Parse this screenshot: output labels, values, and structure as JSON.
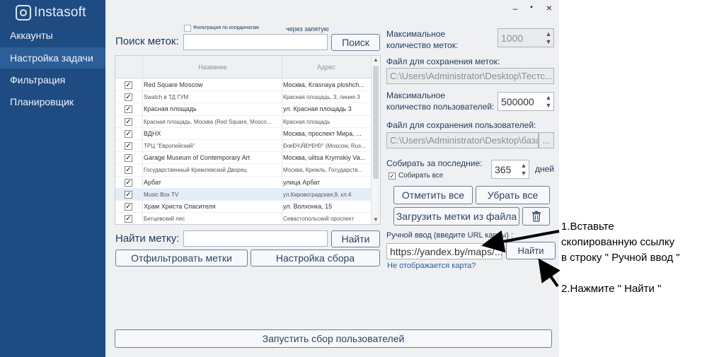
{
  "app": {
    "logo_text": "Instasoft"
  },
  "sidebar": {
    "items": [
      {
        "label": "Аккаунты"
      },
      {
        "label": "Настройка задачи"
      },
      {
        "label": "Фильтрация"
      },
      {
        "label": "Планировщик"
      }
    ],
    "active_index": 1
  },
  "window_controls": {
    "minimize": "–",
    "maximize": "▪",
    "close": "×"
  },
  "search": {
    "label": "Поиск меток:",
    "value": "",
    "button": "Поиск",
    "filter_coords_label": "Фильтрация по координатам",
    "comma_label": "через запятую"
  },
  "table": {
    "headers": [
      "Название",
      "Адрес"
    ],
    "rows": [
      {
        "name": "Red Square Moscow",
        "address": "Москва, Krasnaya ploshch...",
        "checked": true
      },
      {
        "name": "Swatch в ТД ГУМ",
        "address": "Красная площадь, 3, линия 3",
        "checked": true
      },
      {
        "name": "Красная площадь",
        "address": "ул. Красная площадь 3",
        "checked": true
      },
      {
        "name": "Красная площадь, Москва (Red Square, Mosco...",
        "address": "Красная площадь",
        "checked": true
      },
      {
        "name": "ВДНХ",
        "address": "Москва, проспект Мира, ...",
        "checked": true
      },
      {
        "name": "ТРЦ \"Европейский\"",
        "address": "ÐœÐ¾ÑÐºÐ²Ð° (Moscow, Rus...",
        "checked": true
      },
      {
        "name": "Garage Museum of Contemporary Art",
        "address": "Москва, ulitsa Krymskiy Va...",
        "checked": true
      },
      {
        "name": "Государственный Кремлевский Дворец",
        "address": "Москва, Кремль, Государств...",
        "checked": true
      },
      {
        "name": "Арбат",
        "address": "улица Арбат",
        "checked": true
      },
      {
        "name": "Music Box TV",
        "address": "ул.Кировоградская,9, кл.4",
        "checked": true
      },
      {
        "name": "Храм Христа Спасителя",
        "address": "ул. Волхонка, 15",
        "checked": true
      },
      {
        "name": "Битцевский лес",
        "address": "Севастопольский проспект",
        "checked": true
      }
    ]
  },
  "find": {
    "label": "Найти метку:",
    "value": "",
    "button": "Найти"
  },
  "actions": {
    "filter_button": "Отфильтровать метки",
    "settings_button": "Настройка сбора",
    "start_button": "Запустить сбор пользователей"
  },
  "right_panel": {
    "max_tags_label": "Максимальное\nколичество меток:",
    "max_tags_value": "1000",
    "tags_file_label": "Файл для сохранения меток:",
    "tags_file_value": "C:\\Users\\Administrator\\Desktop\\Тестс...",
    "max_users_label": "Максимальное\nколичество пользователей:",
    "max_users_value": "500000",
    "users_file_label": "Файл для сохранения пользователей:",
    "users_file_value": "C:\\Users\\Administrator\\Desktop\\база",
    "browse_label": "...",
    "collect_label": "Собирать за последние:",
    "collect_all_label": "Собирать все",
    "days_value": "365",
    "days_unit": "дней",
    "mark_all": "Отметить все",
    "unmark_all": "Убрать все",
    "load_file": "Загрузить метки из файла",
    "manual_label": "Ручной ввод (введите URL карты) :",
    "manual_value": "https://yandex.by/maps/...",
    "manual_button": "Найти",
    "no_map_link": "Не отображается карта?"
  },
  "annotations": {
    "step1_line1": "1.Вставьте",
    "step1_line2": "скопированную ссылку",
    "step1_line3": "в строку \" Ручной ввод \"",
    "step2": "2.Нажмите \" Найти \""
  },
  "colors": {
    "sidebar_bg": "#1e4b82",
    "sidebar_active": "#2c5e98",
    "main_bg": "#eef0f2",
    "text": "#1f3a5c"
  }
}
